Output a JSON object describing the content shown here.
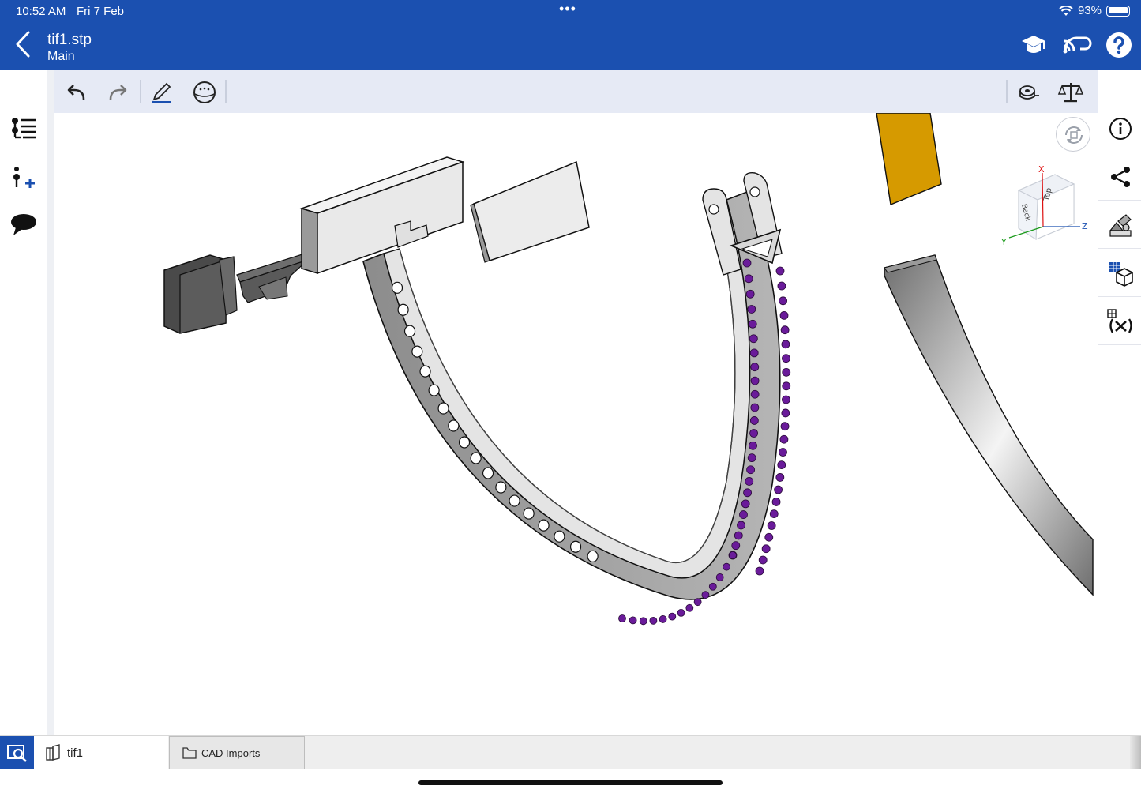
{
  "status_bar": {
    "time": "10:52 AM",
    "date": "Fri 7 Feb",
    "dots": "•••",
    "battery": "93%"
  },
  "header": {
    "title": "tif1.stp",
    "subtitle": "Main",
    "icons": [
      "back-chevron-icon",
      "graduation-cap-icon",
      "connect-cloud-icon",
      "help-icon"
    ]
  },
  "toolbar": {
    "icons": [
      "undo-icon",
      "redo-icon",
      "sketch-pencil-icon",
      "display-style-icon",
      "measure-tape-icon",
      "mass-properties-icon"
    ]
  },
  "left_rail": {
    "icons": [
      "feature-tree-icon",
      "add-instance-icon",
      "comments-icon",
      "collapse-toggle-icon"
    ]
  },
  "right_rail": {
    "icons": [
      "info-icon",
      "share-icon",
      "appearance-icon",
      "bom-table-icon",
      "variables-icon"
    ]
  },
  "view_cube": {
    "faces": {
      "back": "Back",
      "top": "Top"
    },
    "axes": {
      "x": "X",
      "y": "Y",
      "z": "Z"
    }
  },
  "bottom_tabs": {
    "search_icon": "search-tabs-icon",
    "tabs": [
      {
        "label": "tif1",
        "icon": "part-studio-icon",
        "active": true
      },
      {
        "label": "CAD Imports",
        "icon": "folder-icon",
        "active": false
      }
    ]
  },
  "colors": {
    "header_bg": "#1b50b0",
    "toolbar_bg": "#e6eaf5",
    "gem_purple": "#6a1b9a",
    "gold_part": "#d69a00",
    "grey_part": "#8a8a8a"
  }
}
